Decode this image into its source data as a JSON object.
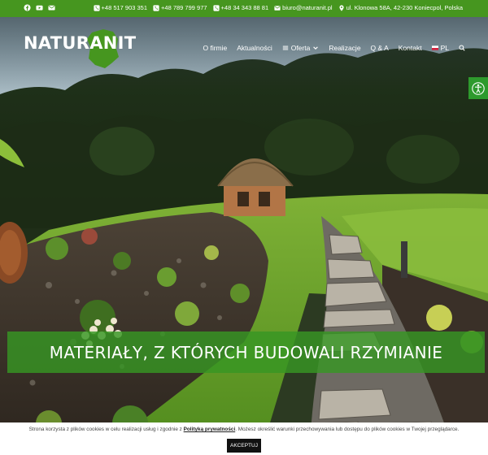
{
  "topbar": {
    "social": [
      "facebook-icon",
      "youtube-icon",
      "email-icon"
    ],
    "phones": [
      "+48 517 903 351",
      "+48 789 799 977",
      "+48 34 343 88 81"
    ],
    "email": "biuro@naturanit.pl",
    "address": "ul. Klonowa 58A, 42-230 Koniecpol, Polska"
  },
  "header": {
    "logo": "NATURANIT",
    "nav": [
      "O firmie",
      "Aktualności",
      "Oferta",
      "Realizacje",
      "Q & A",
      "Kontakt"
    ],
    "language": "PL"
  },
  "hero": {
    "title": "MATERIAŁY, Z KTÓRYCH BUDOWALI RZYMIANIE"
  },
  "cookie": {
    "text_before": "Strona korzysta z plików cookies w celu realizacji usług i zgodnie z ",
    "link": "Polityką prywatności",
    "text_after": ". Możesz określić warunki przechowywania lub dostępu do plików cookies w Twojej przeglądarce.",
    "accept": "AKCEPTUJ"
  },
  "colors": {
    "brand_green": "#46961f",
    "banner_green": "#379623",
    "cookie_button": "#111111"
  }
}
